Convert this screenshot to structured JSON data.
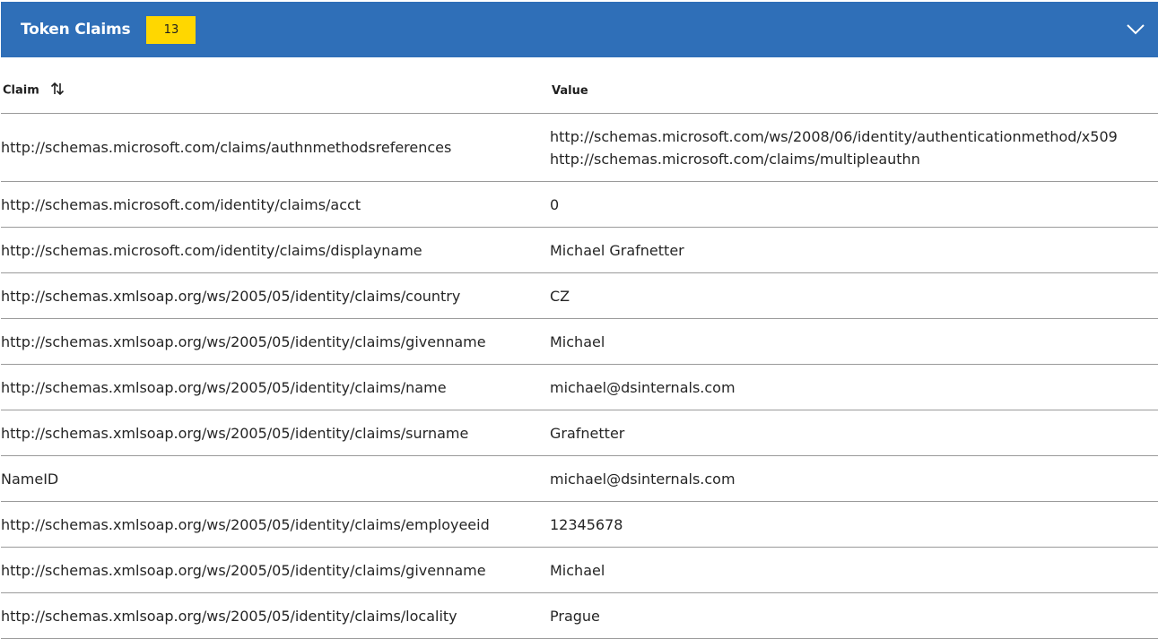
{
  "panel": {
    "title": "Token Claims",
    "count": "13",
    "header_color": "#2f6fb8",
    "badge_color": "#ffd700",
    "toggle_icon": "chevron-down-icon"
  },
  "table": {
    "headers": {
      "claim": "Claim",
      "value": "Value",
      "sort_icon": "sort-arrows-icon"
    },
    "rows": [
      {
        "claim": "http://schemas.microsoft.com/claims/authnmethodsreferences",
        "values": [
          "http://schemas.microsoft.com/ws/2008/06/identity/authenticationmethod/x509",
          "http://schemas.microsoft.com/claims/multipleauthn"
        ]
      },
      {
        "claim": "http://schemas.microsoft.com/identity/claims/acct",
        "values": [
          "0"
        ]
      },
      {
        "claim": "http://schemas.microsoft.com/identity/claims/displayname",
        "values": [
          "Michael Grafnetter"
        ]
      },
      {
        "claim": "http://schemas.xmlsoap.org/ws/2005/05/identity/claims/country",
        "values": [
          "CZ"
        ]
      },
      {
        "claim": "http://schemas.xmlsoap.org/ws/2005/05/identity/claims/givenname",
        "values": [
          "Michael"
        ]
      },
      {
        "claim": "http://schemas.xmlsoap.org/ws/2005/05/identity/claims/name",
        "values": [
          "michael@dsinternals.com"
        ]
      },
      {
        "claim": "http://schemas.xmlsoap.org/ws/2005/05/identity/claims/surname",
        "values": [
          "Grafnetter"
        ]
      },
      {
        "claim": "NameID",
        "values": [
          "michael@dsinternals.com"
        ]
      },
      {
        "claim": "http://schemas.xmlsoap.org/ws/2005/05/identity/claims/employeeid",
        "values": [
          "12345678"
        ]
      },
      {
        "claim": "http://schemas.xmlsoap.org/ws/2005/05/identity/claims/givenname",
        "values": [
          "Michael"
        ]
      },
      {
        "claim": "http://schemas.xmlsoap.org/ws/2005/05/identity/claims/locality",
        "values": [
          "Prague"
        ]
      }
    ]
  }
}
